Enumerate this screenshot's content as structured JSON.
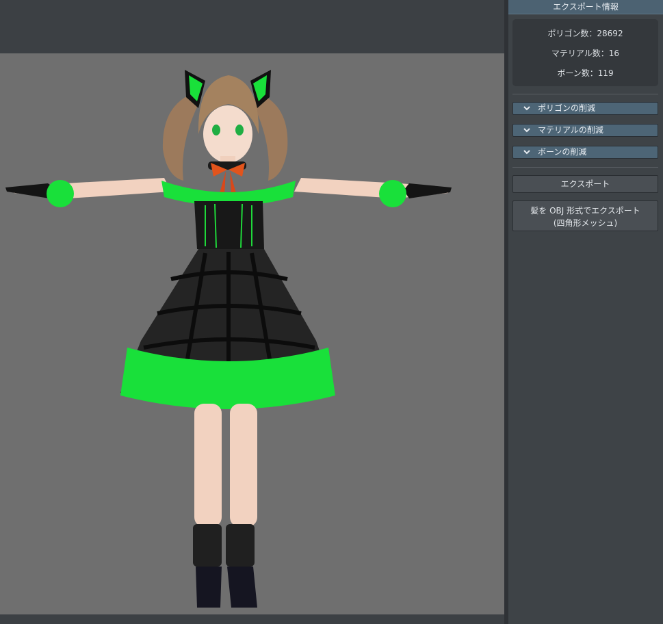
{
  "panel": {
    "title": "エクスポート情報",
    "stats": {
      "polygons": "ポリゴン数：28692",
      "materials": "マテリアル数：16",
      "bones": "ボーン数：119"
    },
    "sections": [
      {
        "label": "ポリゴンの削減",
        "icon": "chevron-down-icon"
      },
      {
        "label": "マテリアルの削減",
        "icon": "chevron-down-icon"
      },
      {
        "label": "ボーンの削減",
        "icon": "chevron-down-icon"
      }
    ],
    "export_button": "エクスポート",
    "obj_export_button": {
      "line1": "髪を OBJ 形式でエクスポート",
      "line2": "(四角形メッシュ)"
    }
  },
  "colors": {
    "viewport_bg": "#6f6f6f",
    "panel_bg": "#3e4347",
    "header_bg": "#4c6272",
    "accent_green": "#19e03a"
  }
}
